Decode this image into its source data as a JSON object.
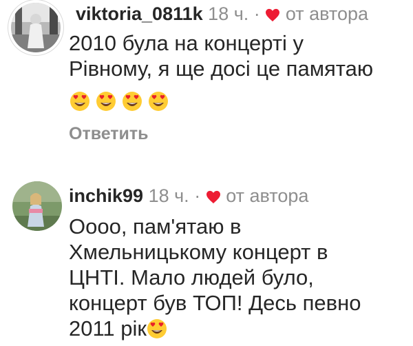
{
  "comments": [
    {
      "username": "viktoria_0811k",
      "time": "18 ч.",
      "separator": "·",
      "author_like": "от автора",
      "lines": [
        "2010 була на концерті у",
        "Рівному,  я ще досі це памятаю"
      ],
      "emoji_count": 4,
      "emoji_name": "heart-eyes-emoji",
      "reply_label": "Ответить"
    },
    {
      "username": "inchik99",
      "time": "18 ч.",
      "separator": "·",
      "author_like": "от автора",
      "lines": [
        "Оооо, пам'ятаю в",
        "Хмельницькому концерт в",
        "ЦНТІ. Мало людей було,",
        "концерт був ТОП! Десь певно",
        "2011 рік"
      ],
      "emoji_name": "heart-eyes-emoji"
    }
  ],
  "colors": {
    "username": "#262626",
    "meta": "#8e8e8e",
    "heart": "#ed1c33",
    "emoji_face": "#ffcc33"
  }
}
